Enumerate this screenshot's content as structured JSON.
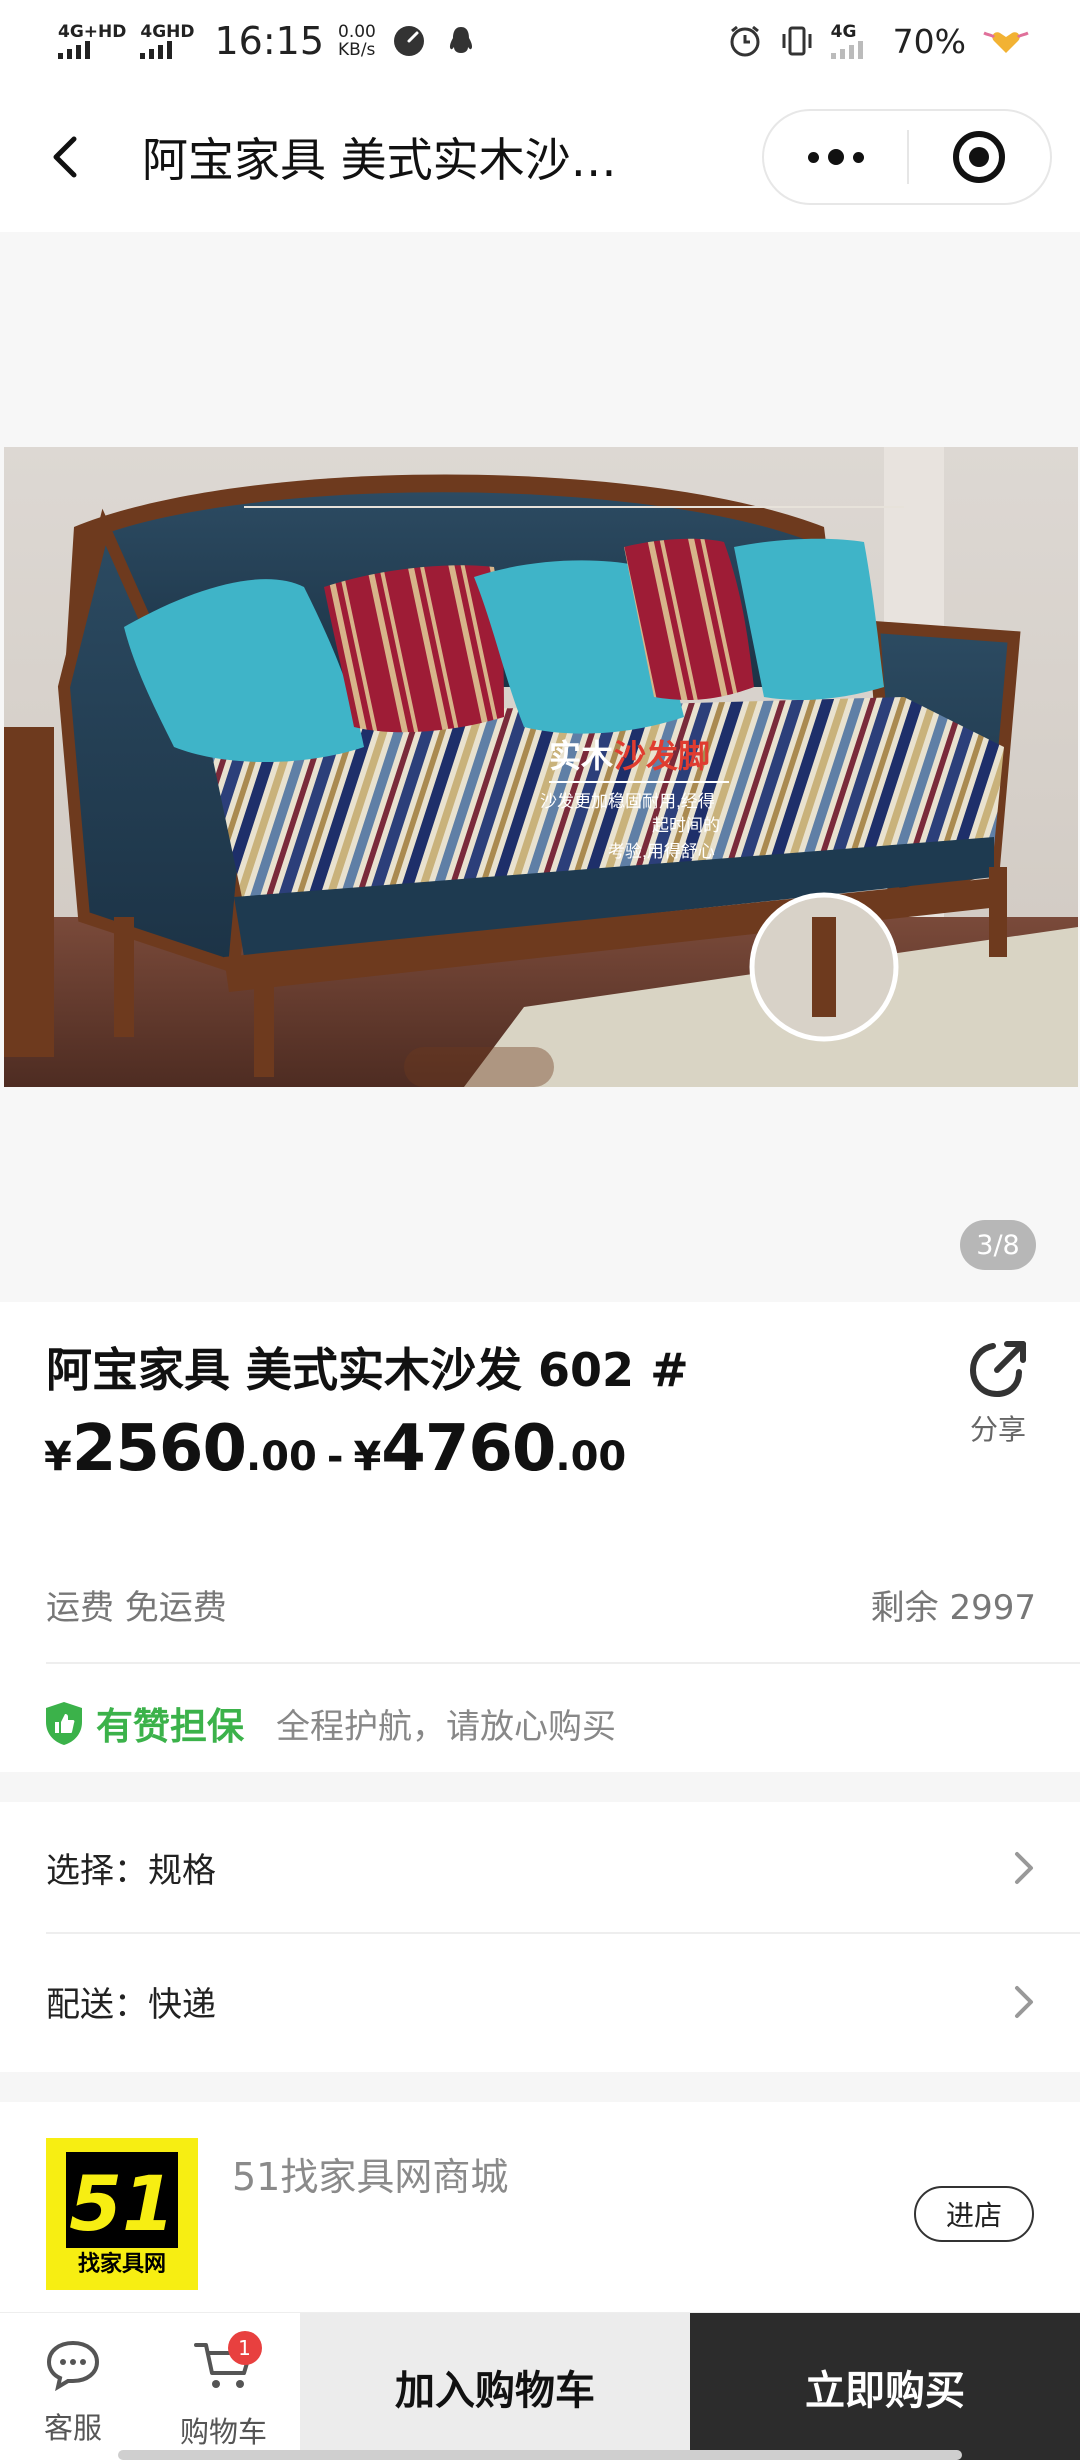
{
  "status_bar": {
    "net1": "4G+HD",
    "net2": "4GHD",
    "time": "16:15",
    "speed_value": "0.00",
    "speed_unit": "KB/s",
    "net3": "4G",
    "battery": "70%"
  },
  "nav": {
    "title": "阿宝家具 美式实木沙…"
  },
  "gallery": {
    "counter": "3/8",
    "overlay_title_a": "实木",
    "overlay_title_b": "沙发脚",
    "overlay_line1": "沙发更加稳固耐用,经得",
    "overlay_line2": "起时间的",
    "overlay_line3": "考验,用得舒心"
  },
  "product": {
    "title": "阿宝家具 美式实木沙发 602 #",
    "share_label": "分享",
    "currency": "¥",
    "price_low_int": "2560",
    "price_low_dec": ".00",
    "price_sep": "-",
    "price_high_int": "4760",
    "price_high_dec": ".00",
    "freight": "运费 免运费",
    "stock": "剩余 2997",
    "guarantee_title": "有赞担保",
    "guarantee_text": "全程护航，请放心购买"
  },
  "options": {
    "spec": "选择：规格",
    "delivery": "配送：快递"
  },
  "shop": {
    "logo_number": "51",
    "logo_text": "找家具网",
    "name": "51找家具网商城",
    "enter_label": "进店"
  },
  "bottom_bar": {
    "service_label": "客服",
    "cart_label": "购物车",
    "cart_badge": "1",
    "add_to_cart": "加入购物车",
    "buy_now": "立即购买"
  },
  "colors": {
    "guarantee_green": "#3bb24a",
    "buy_button": "#2c2c2c",
    "badge_red": "#e8403f",
    "logo_yellow": "#f7ee12"
  }
}
